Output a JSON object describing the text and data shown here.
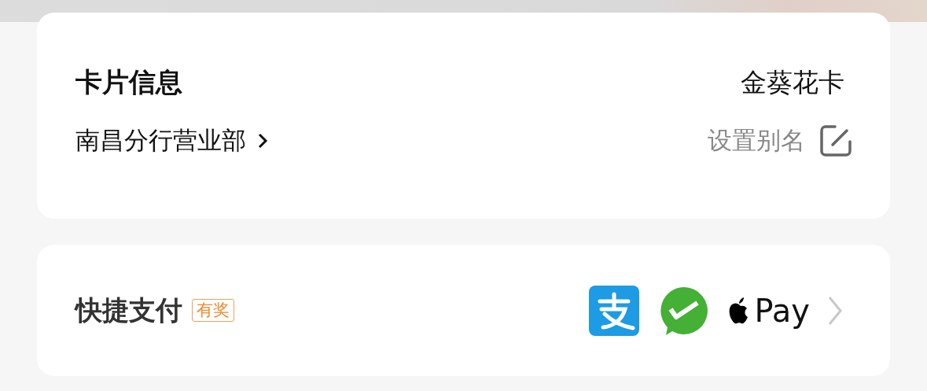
{
  "card_info": {
    "title": "卡片信息",
    "card_type": "金葵花卡",
    "branch": "南昌分行营业部",
    "alias_action": "设置别名"
  },
  "quick_pay": {
    "title": "快捷支付",
    "badge": "有奖",
    "pay_text": "Pay"
  }
}
